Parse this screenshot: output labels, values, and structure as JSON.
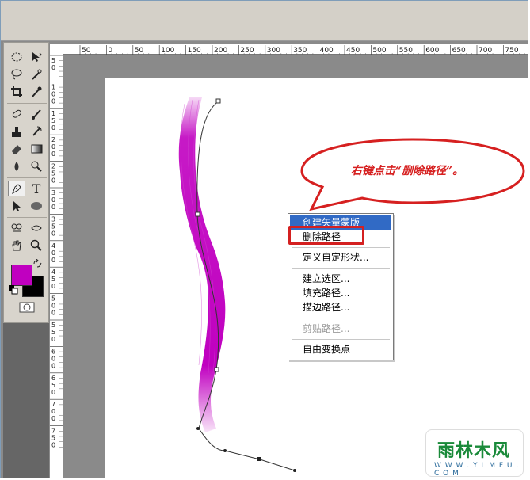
{
  "ruler": {
    "h_ticks": [
      "50",
      "0",
      "50",
      "100",
      "150",
      "200",
      "250",
      "300",
      "350",
      "400",
      "450",
      "500",
      "550",
      "600",
      "650",
      "700",
      "750"
    ],
    "v_labels": [
      "5\n0",
      "1\n0\n0",
      "1\n5\n0",
      "2\n0\n0",
      "2\n5\n0",
      "3\n0\n0",
      "3\n5\n0",
      "4\n0\n0",
      "4\n5\n0",
      "5\n0\n0",
      "5\n5\n0",
      "6\n0\n0",
      "6\n5\n0",
      "7\n0\n0",
      "7\n5\n0"
    ]
  },
  "context_menu": {
    "items": [
      {
        "label": "创建矢量蒙版",
        "state": "highlighted"
      },
      {
        "label": "删除路径",
        "state": "normal"
      },
      {
        "label": "定义自定形状...",
        "state": "normal"
      },
      {
        "label": "建立选区...",
        "state": "normal"
      },
      {
        "label": "填充路径...",
        "state": "normal"
      },
      {
        "label": "描边路径...",
        "state": "normal"
      },
      {
        "label": "剪贴路径...",
        "state": "disabled"
      },
      {
        "label": "自由变换点",
        "state": "normal"
      }
    ]
  },
  "callout": {
    "text": "右键点击“删除路径”。"
  },
  "watermark": {
    "name": "雨林木风",
    "url": "W W W . Y L M F U . C O M"
  },
  "colors": {
    "foreground": "#c000c0",
    "background": "#000000",
    "stroke_paint": "#c000c0",
    "menu_highlight": "#316ac5",
    "callout_red": "#d62020"
  },
  "tools": {
    "active": "pen-tool",
    "type_label": "T"
  }
}
